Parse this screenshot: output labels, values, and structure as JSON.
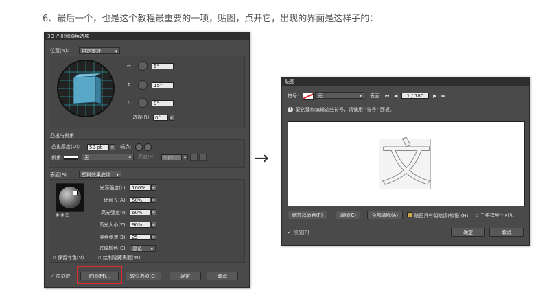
{
  "heading": "6、最后一个，也是这个教程最重要的一项，贴图，点开它，出现的界面是这样子的：",
  "dlg1": {
    "title": "3D 凸出和斜角选项",
    "position_label": "位置(N):",
    "position_value": "自定旋转",
    "rot_x": "5°",
    "rot_y": "15°",
    "rot_z": "0°",
    "persp_label": "透视(R):",
    "persp_value": "0°",
    "extrude_section": "凸出与斜角",
    "depth_label": "凸出厚度(D):",
    "depth_value": "50 pt",
    "cap_label": "端点:",
    "bevel_label": "斜角:",
    "bevel_value": "无",
    "height_label": "高度(H):",
    "height_value": "4 pt",
    "surface_label": "表面(S):",
    "surface_value": "塑料效果底纹",
    "light_rows": [
      {
        "label": "光源强度(L):",
        "value": "100%"
      },
      {
        "label": "环境光(A):",
        "value": "50%"
      },
      {
        "label": "高光强度(I):",
        "value": "60%"
      },
      {
        "label": "高光大小(Z):",
        "value": "90%"
      },
      {
        "label": "混合步骤(B):",
        "value": "25"
      }
    ],
    "shade_label": "底纹颜色(C):",
    "shade_value": "黑色",
    "light_icons": "◉ ◉  ◫",
    "preserve_spot": "保留专色(V)",
    "draw_hidden": "绘制隐藏表面(W)",
    "preview": "✓ 预览(P)",
    "map_button": "贴图(M)...",
    "fewer_options": "较少选项(O)",
    "ok": "确定",
    "cancel": "取消"
  },
  "arrow": "→",
  "dlg2": {
    "title": "贴图",
    "symbol_label": "符号:",
    "symbol_value": "无",
    "surface_label": "表面:",
    "nav_first": "⏮",
    "nav_prev": "◀",
    "surface_value": "1 / 180",
    "nav_next": "▶",
    "nav_last": "⏭",
    "info_icon": "i",
    "info_text": "要创建和编辑这些符号，请使用 \"符号\" 面板。",
    "preview_char": "文",
    "scale_to_fit": "缩放以适合(F)",
    "clear": "清除(C)",
    "clear_all": "全部清除(A)",
    "shade_artwork": "贴图具有明暗调(较慢)(H)",
    "invisible_geom": "三维模型不可见",
    "preview": "✓ 预览(P)",
    "ok": "确定",
    "cancel": "取消"
  },
  "colors": {
    "dialog_bg": "#4a4a4a",
    "sphere_blue": "#5aa8c8",
    "highlight_red": "#e02a2a"
  }
}
